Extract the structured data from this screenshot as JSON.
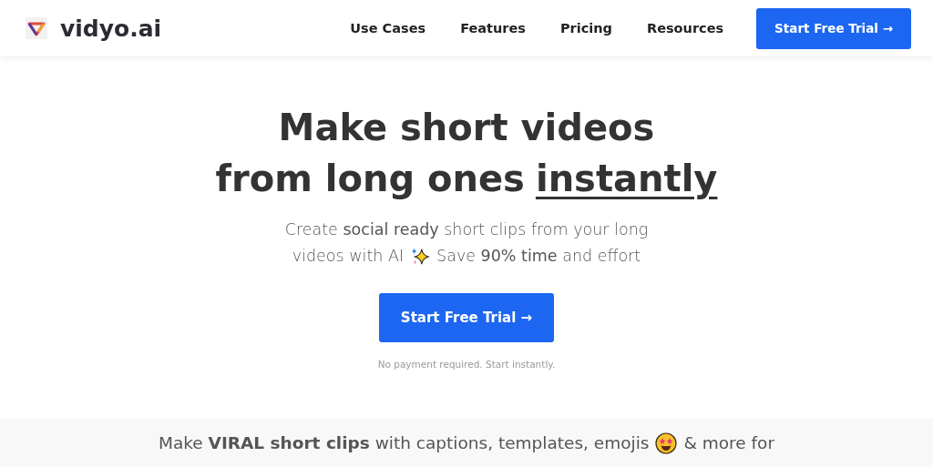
{
  "header": {
    "brand": "vidyo.ai",
    "nav": [
      "Use Cases",
      "Features",
      "Pricing",
      "Resources"
    ],
    "cta": "Start Free Trial →"
  },
  "hero": {
    "headline_line_1": "Make short videos",
    "headline_line_2": "from long ones",
    "headline_emphasis": "instantly",
    "subtitle_line_1": "Create **social ready** short clips from your long",
    "subtitle_before": "videos with AI",
    "subtitle_after": "Save **90% time** and effort",
    "cta": "Start Free Trial →",
    "note": "No payment required. Start instantly."
  },
  "band": {
    "text_before": "Make **VIRAL short clips** with captions, templates, emojis",
    "text_after": "& more for"
  }
}
